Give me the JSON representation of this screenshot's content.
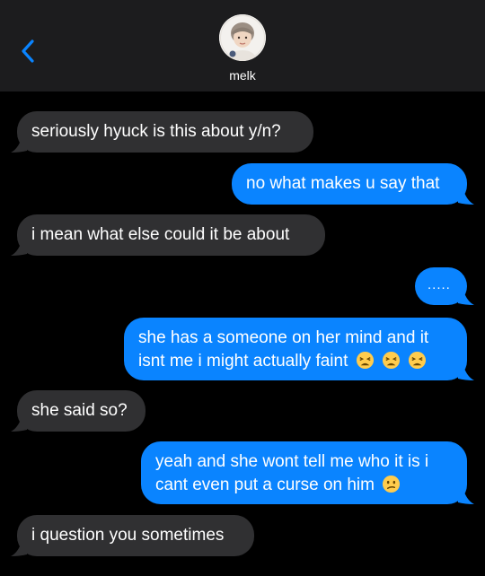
{
  "header": {
    "contact_name": "melk",
    "back_icon": "chevron-left-icon",
    "avatar_icon": "contact-avatar"
  },
  "colors": {
    "header_bg": "#1c1c1e",
    "incoming_bubble": "#303032",
    "outgoing_bubble": "#0a84ff",
    "accent": "#0a84ff"
  },
  "messages": [
    {
      "direction": "incoming",
      "text": "seriously hyuck is this about y/n?"
    },
    {
      "direction": "outgoing",
      "text": "no what makes u say that"
    },
    {
      "direction": "incoming",
      "text": "i mean what else could it be about"
    },
    {
      "direction": "outgoing",
      "text": "....."
    },
    {
      "direction": "outgoing",
      "line1": "she has a someone on her mind and it",
      "line2": "isnt me i might actually faint",
      "emoji": "tired-face-emoji"
    },
    {
      "direction": "incoming",
      "text": "she said so?"
    },
    {
      "direction": "outgoing",
      "line1": "yeah and she wont tell me who it is i",
      "line2": "cant even put a curse on him",
      "emoji": "confused-face-emoji"
    },
    {
      "direction": "incoming",
      "text": "i question you sometimes"
    }
  ]
}
